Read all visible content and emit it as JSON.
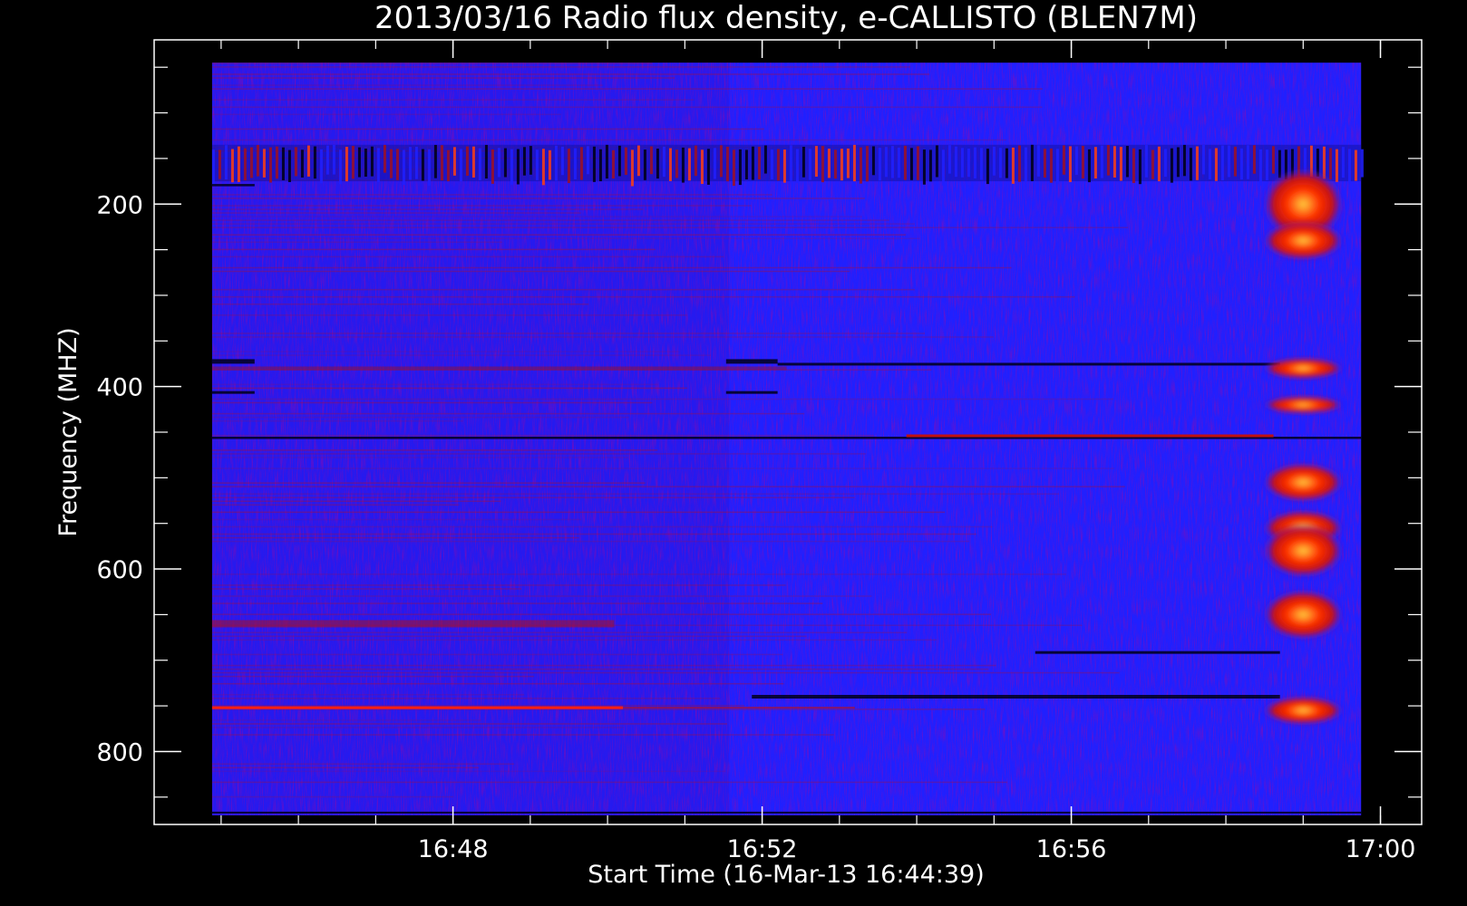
{
  "chart_data": {
    "type": "heatmap",
    "title": "2013/03/16  Radio flux density, e-CALLISTO (BLEN7M)",
    "xlabel": "Start Time (16-Mar-13 16:44:39)",
    "ylabel": "Frequency (MHZ)",
    "x_ticks": [
      {
        "label": "16:48",
        "value": 208
      },
      {
        "label": "16:52",
        "value": 448
      },
      {
        "label": "16:56",
        "value": 688
      },
      {
        "label": "17:00",
        "value": 928
      }
    ],
    "x_range_s": [
      -24,
      960
    ],
    "x_data_range_s": [
      21,
      913
    ],
    "y_ticks": [
      200,
      400,
      600,
      800
    ],
    "y_range": [
      20,
      880
    ],
    "y_data_range": [
      45,
      870
    ],
    "grid": false,
    "colormap": [
      "#000000",
      "#1010e8",
      "#2020ff",
      "#c01010",
      "#ff3000",
      "#ffd040"
    ],
    "features": [
      {
        "name": "interference band",
        "freq_mhz": [
          135,
          175
        ],
        "t_s": [
          21,
          913
        ],
        "pattern": "vertical-stripes"
      },
      {
        "name": "narrowband emission",
        "freq_mhz": 752,
        "t_s": [
          21,
          340
        ],
        "intensity": "high"
      },
      {
        "name": "narrowband line",
        "freq_mhz": 454,
        "t_s": [
          21,
          913
        ],
        "intensity": "medium"
      },
      {
        "name": "radio burst",
        "t_s": [
          850,
          885
        ],
        "freq_mhz": [
          180,
          770
        ],
        "intensity": "very-high"
      }
    ]
  }
}
